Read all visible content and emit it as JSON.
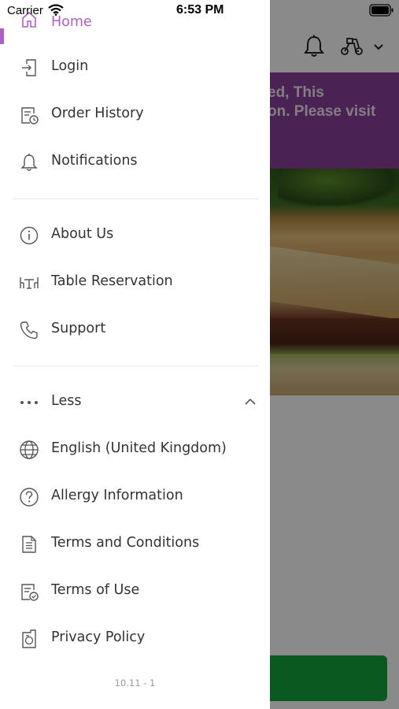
{
  "status_bar": {
    "carrier": "Carrier",
    "time": "6:53 PM"
  },
  "drawer": {
    "items_top": [
      {
        "label": "Home",
        "icon": "home-icon",
        "active": true
      },
      {
        "label": "Login",
        "icon": "login-icon"
      },
      {
        "label": "Order History",
        "icon": "order-history-icon"
      },
      {
        "label": "Notifications",
        "icon": "bell-icon"
      }
    ],
    "items_middle": [
      {
        "label": "About Us",
        "icon": "info-icon"
      },
      {
        "label": "Table Reservation",
        "icon": "table-reservation-icon"
      },
      {
        "label": "Support",
        "icon": "phone-icon"
      }
    ],
    "more_toggle": {
      "label": "Less",
      "icon": "ellipsis-icon",
      "expanded": true
    },
    "items_bottom": [
      {
        "label": "English (United Kingdom)",
        "icon": "globe-icon"
      },
      {
        "label": "Allergy Information",
        "icon": "question-icon"
      },
      {
        "label": "Terms and Conditions",
        "icon": "document-icon"
      },
      {
        "label": "Terms of Use",
        "icon": "document-check-icon"
      },
      {
        "label": "Privacy Policy",
        "icon": "privacy-icon"
      }
    ],
    "version": "10.11 - 1"
  },
  "background": {
    "banner_line_1": "ed, This",
    "banner_line_2": "on. Please visit",
    "banner_color": "#8a3f9a",
    "button_color": "#14a43d"
  },
  "colors": {
    "accent": "#b05ec7",
    "text": "#333333",
    "icon": "#555555"
  }
}
